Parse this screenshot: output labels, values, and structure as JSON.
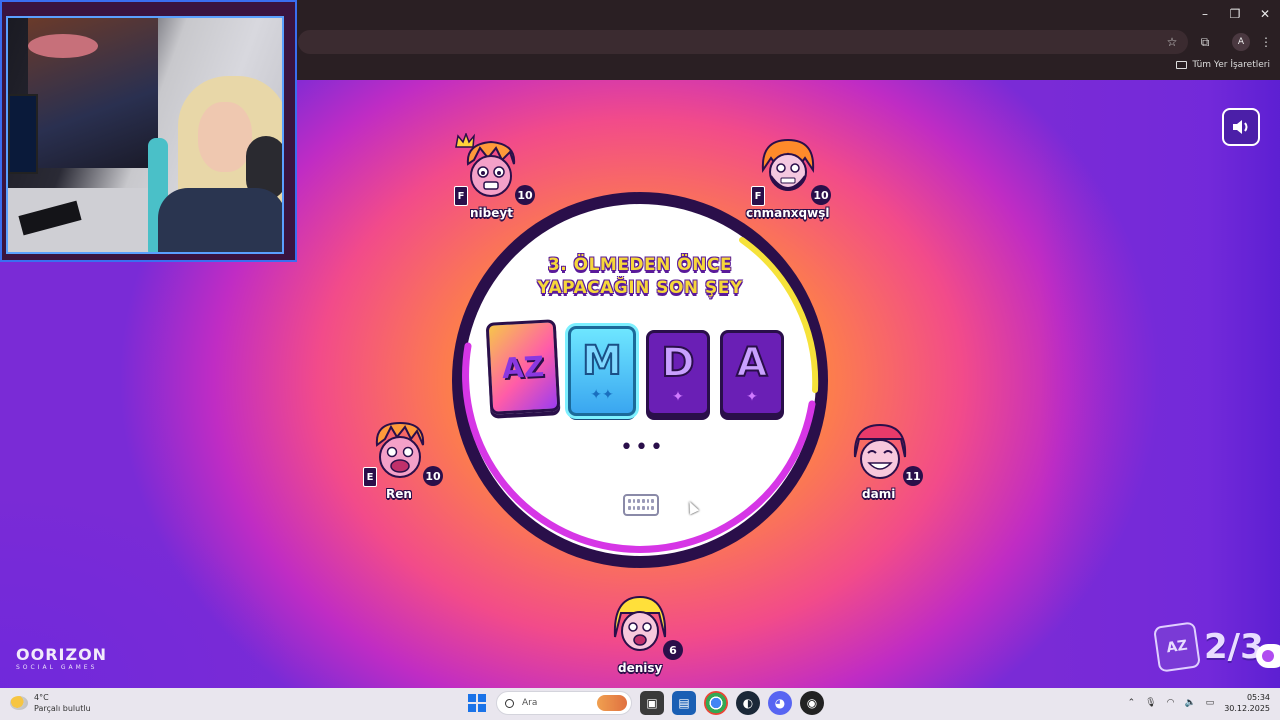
{
  "browser": {
    "window_controls": {
      "minimize": "–",
      "maximize": "❐",
      "close": "✕"
    },
    "toolbar_icons": [
      "star-icon",
      "extensions-icon",
      "menu-icon"
    ],
    "profile_initial": "A",
    "bookmarks_label": "Tüm Yer İşaretleri"
  },
  "game": {
    "question": "3. ÖLMEDEN ÖNCE YAPACAĞIN SON ŞEY",
    "tiles": [
      {
        "kind": "az",
        "label": "AZ"
      },
      {
        "kind": "letter",
        "letter": "M",
        "sparkles": "✦✦",
        "highlighted": true
      },
      {
        "kind": "letter",
        "letter": "D",
        "sparkles": "✦"
      },
      {
        "kind": "letter",
        "letter": "A",
        "sparkles": "✦"
      }
    ],
    "typing_indicator": "•••",
    "timer_color": "#f6e23a",
    "ring_color": "#d636e6",
    "players": [
      {
        "name": "nibeyt",
        "score": "10",
        "badge": "F",
        "crown": true
      },
      {
        "name": "cnmanxqwşl",
        "score": "10",
        "badge": "F"
      },
      {
        "name": "Ren",
        "score": "10",
        "badge": "E"
      },
      {
        "name": "dami",
        "score": "11"
      },
      {
        "name": "denisy",
        "score": "6"
      }
    ],
    "round_progress": "2/3",
    "progress_icon_label": "AZ",
    "logo": {
      "name": "OORIZON",
      "subtitle": "SOCIAL GAMES"
    }
  },
  "taskbar": {
    "weather_temp": "4°C",
    "weather_desc": "Parçalı bulutlu",
    "search_placeholder": "Ara",
    "time": "05:34",
    "date": "30.12.2025",
    "tray_icons": [
      "chevron-up-icon",
      "mic-icon",
      "wifi-icon",
      "speaker-icon",
      "battery-icon"
    ]
  }
}
